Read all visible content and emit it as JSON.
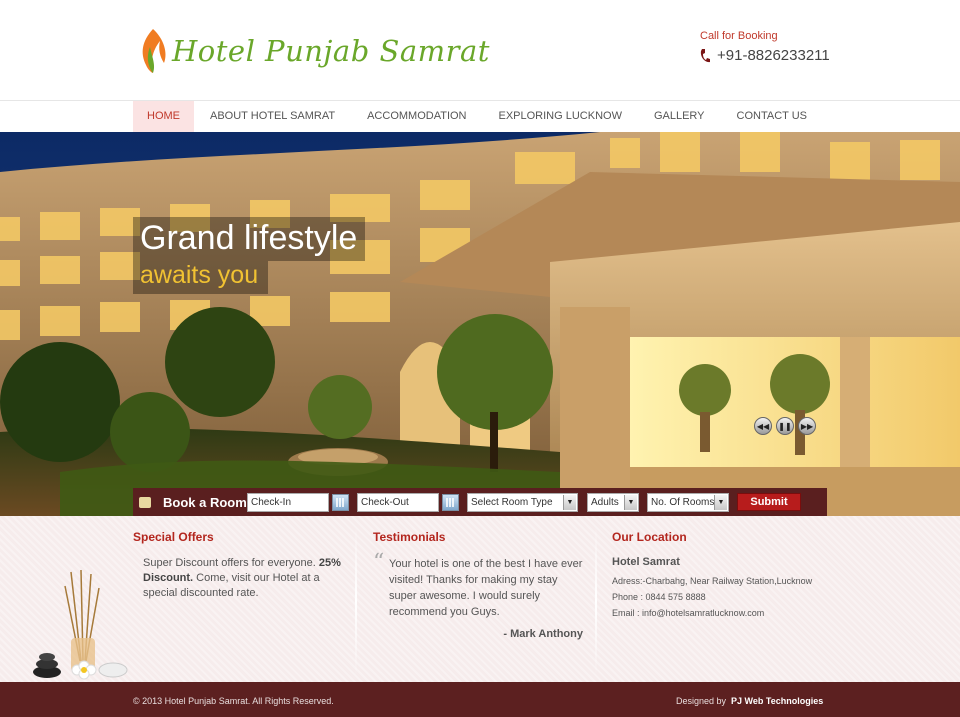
{
  "header": {
    "logo_text": "Hotel Punjab Samrat",
    "booking_label": "Call for Booking",
    "booking_phone": "+91-8826233211"
  },
  "nav": {
    "items": [
      "HOME",
      "ABOUT HOTEL SAMRAT",
      "ACCOMMODATION",
      "EXPLORING LUCKNOW",
      "GALLERY",
      "CONTACT US"
    ],
    "active": "HOME"
  },
  "hero": {
    "title": "Grand lifestyle",
    "subtitle": "awaits you",
    "controls": [
      "previous-icon",
      "pause-icon",
      "next-icon"
    ]
  },
  "booking_bar": {
    "title": "Book a Room",
    "checkin_placeholder": "Check-In",
    "checkout_placeholder": "Check-Out",
    "room_type": "Select Room Type",
    "adults": "Adults",
    "rooms": "No. Of Rooms",
    "submit": "Submit"
  },
  "offers": {
    "heading": "Special Offers",
    "text_before": "Super Discount offers for everyone. ",
    "bold": "25% Discount.",
    "text_after": " Come, visit our Hotel at a special discounted rate."
  },
  "testimonials": {
    "heading": "Testimonials",
    "quote": "Your hotel is one of the best I have ever visited! Thanks for making my stay super awesome. I would surely recommend you Guys.",
    "author": "- Mark Anthony"
  },
  "location": {
    "heading": "Our Location",
    "name": "Hotel Samrat",
    "address": "Adress:-Charbahg, Near Railway Station,Lucknow",
    "phone": "Phone : 0844 575 8888",
    "email": "Email : info@hotelsamratlucknow.com"
  },
  "footer": {
    "copyright": "© 2013 Hotel Punjab Samrat. All Rights Reserved.",
    "designed_by_label": "Designed by",
    "designer": "PJ Web Technologies"
  },
  "colors": {
    "accent_red": "#b3261e",
    "logo_green": "#6aa72a",
    "footer_bg": "#5c2020",
    "gold": "#f1c232"
  }
}
